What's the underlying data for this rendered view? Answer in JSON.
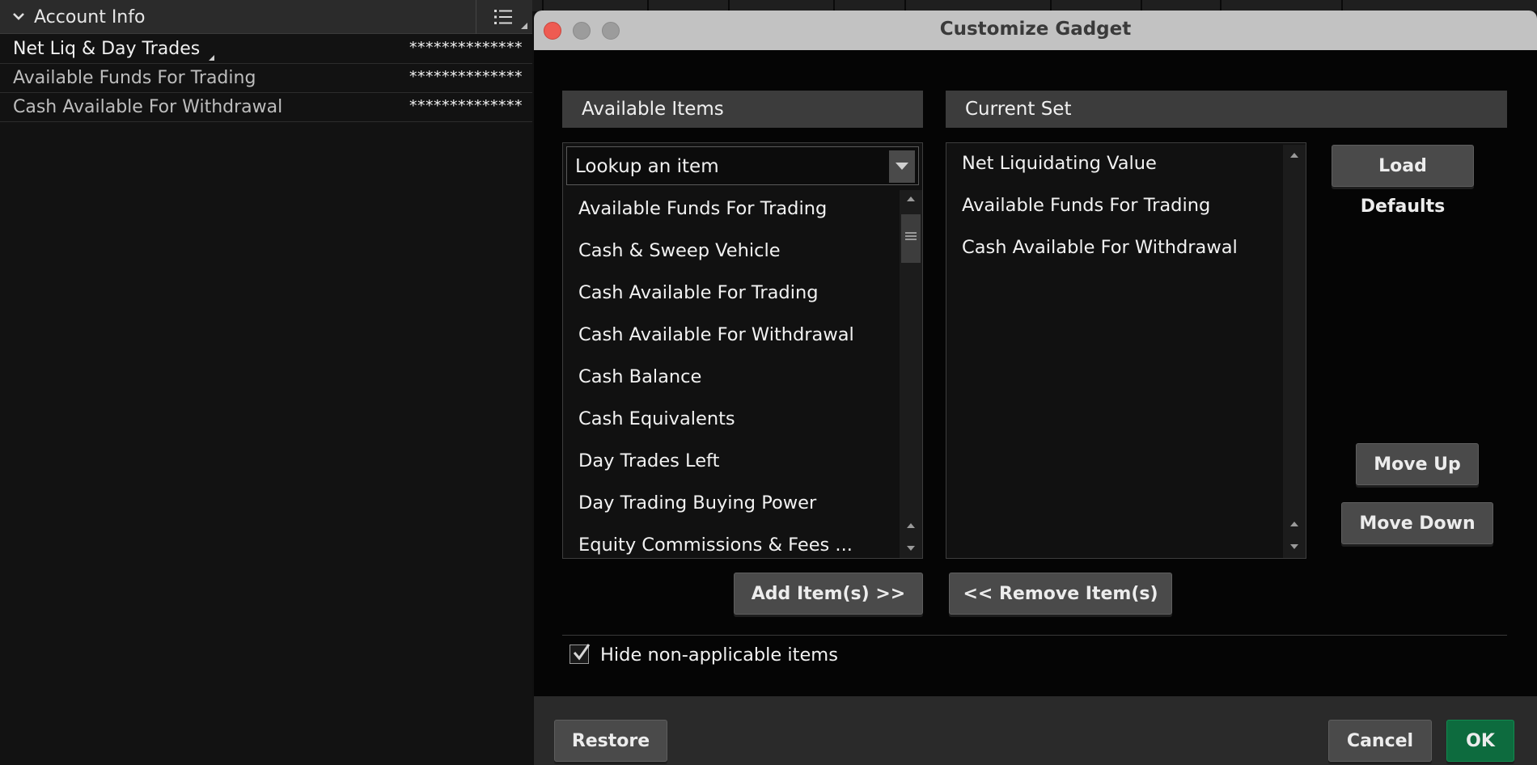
{
  "account_panel": {
    "title": "Account Info",
    "rows": [
      {
        "label": "Net Liq & Day Trades",
        "value": "**************"
      },
      {
        "label": "Available Funds For Trading",
        "value": "**************"
      },
      {
        "label": "Cash Available For Withdrawal",
        "value": "**************"
      }
    ]
  },
  "dialog": {
    "title": "Customize Gadget",
    "available_header": "Available Items",
    "current_header": "Current Set",
    "lookup_placeholder": "Lookup an item",
    "available_items": [
      "Available Funds For Trading",
      "Cash & Sweep Vehicle",
      "Cash Available For Trading",
      "Cash Available For Withdrawal",
      "Cash Balance",
      "Cash Equivalents",
      "Day Trades Left",
      "Day Trading Buying Power",
      "Equity Commissions & Fees ..."
    ],
    "current_items": [
      "Net Liquidating Value",
      "Available Funds For Trading",
      "Cash Available For Withdrawal"
    ],
    "buttons": {
      "load_defaults": "Load Defaults",
      "move_up": "Move Up",
      "move_down": "Move Down",
      "add_items": "Add Item(s) >>",
      "remove_items": "<< Remove Item(s)",
      "restore": "Restore",
      "cancel": "Cancel",
      "ok": "OK"
    },
    "hide_checkbox_label": "Hide non-applicable items",
    "hide_checkbox_checked": true
  },
  "colors": {
    "ok_button": "#0d6b3e",
    "close_button": "#ee5b52",
    "titlebar": "#c2c2c2"
  }
}
